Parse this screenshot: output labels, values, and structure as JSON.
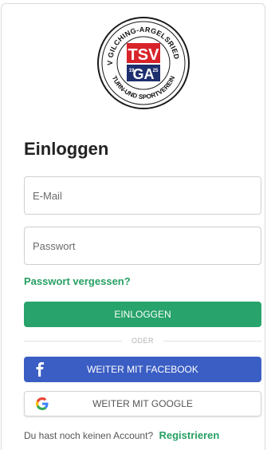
{
  "logo": {
    "arc_top": "TSV GILCHING-ARGELSRIED e.V.",
    "arc_bottom": "TURN-UND SPORTVEREIN",
    "monogram_top": "TSV",
    "monogram_bottom": "GA",
    "year_left": "19",
    "year_right": "25"
  },
  "login": {
    "title": "Einloggen",
    "email_placeholder": "E-Mail",
    "password_placeholder": "Passwort",
    "forgot_label": "Passwort vergessen?",
    "submit_label": "EINLOGGEN"
  },
  "divider": {
    "label": "ODER"
  },
  "social": {
    "facebook_label": "WEITER MIT FACEBOOK",
    "google_label": "WEITER MIT GOOGLE"
  },
  "register": {
    "prompt": "Du hast noch keinen Account?",
    "link_label": "Registrieren"
  },
  "colors": {
    "accent_green": "#27a36b",
    "facebook_blue": "#3b5ec4",
    "logo_red": "#d8232a",
    "logo_navy": "#1d2f6f"
  },
  "icons": {
    "facebook": "facebook-icon",
    "google": "google-icon"
  }
}
